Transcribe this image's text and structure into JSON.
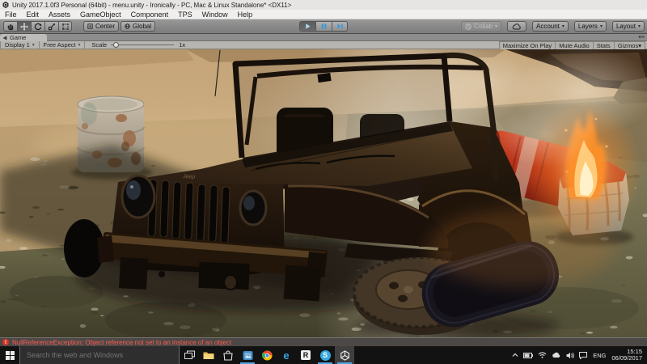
{
  "window": {
    "title": "Unity 2017.1.0f3 Personal (64bit) - menu.unity - Ironically - PC, Mac & Linux Standalone* <DX11>"
  },
  "menubar": {
    "items": [
      "File",
      "Edit",
      "Assets",
      "GameObject",
      "Component",
      "TPS",
      "Window",
      "Help"
    ]
  },
  "toolbar": {
    "tools": [
      "hand-tool",
      "move-tool",
      "rotate-tool",
      "scale-tool",
      "rect-tool"
    ],
    "selected_tool": "move-tool",
    "pivot_label": "Center",
    "space_label": "Global",
    "collab_label": "Collab",
    "account_label": "Account",
    "layers_label": "Layers",
    "layout_label": "Layout",
    "play_state": "playing"
  },
  "game_view": {
    "tab_label": "Game",
    "display_label": "Display 1",
    "aspect_label": "Free Aspect",
    "scale_label": "Scale",
    "scale_value": "1x",
    "maximize_label": "Maximize On Play",
    "mute_label": "Mute Audio",
    "stats_label": "Stats",
    "gizmos_label": "Gizmos"
  },
  "scene": {
    "jeep_badge": "Jeep",
    "objects": [
      "jeep",
      "rusty-barrel",
      "red-barrel",
      "burning-barrel",
      "fire",
      "smoke",
      "tire-flat",
      "tire-dark",
      "rocky-ground"
    ],
    "colors": {
      "haze": "#d8bd92",
      "ground": "#6e6a4e",
      "jeep_body": "#342313",
      "fire": "#ff8a24",
      "barrel_red": "#bf3a22"
    }
  },
  "console": {
    "error": "NullReferenceException: Object reference not set to an instance of an object"
  },
  "taskbar": {
    "search_placeholder": "Search the web and Windows",
    "glyphs": {
      "edge": "e",
      "r": "R",
      "skype": "S"
    },
    "tray": {
      "lang": "ENG",
      "time": "15:15",
      "date": "06/09/2017"
    }
  }
}
